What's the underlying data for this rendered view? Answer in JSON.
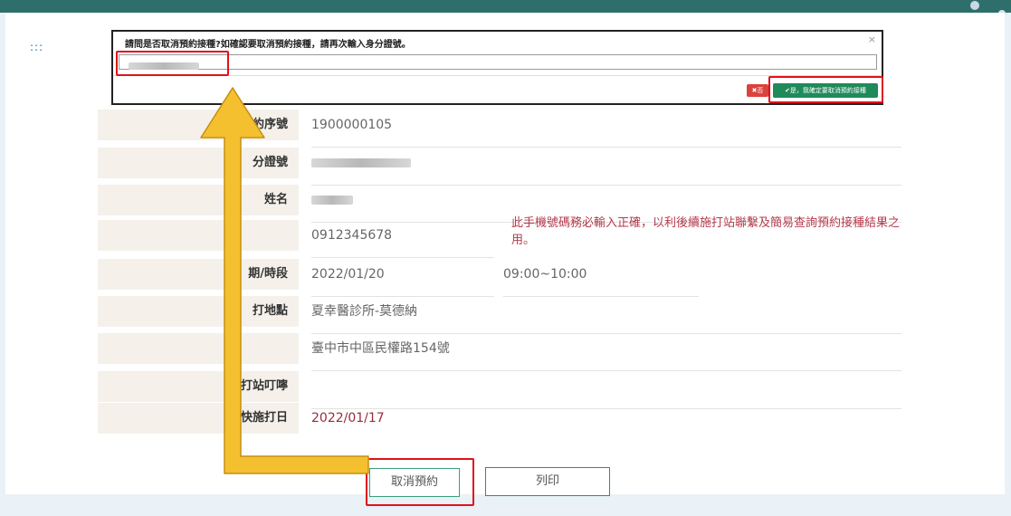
{
  "modal": {
    "prompt": "請問是否取消預約接種?如確認要取消預約接種，請再次輸入身分證號。",
    "close": "×",
    "no_label": "✖否",
    "yes_label": "✔是，我確定要取消預約接種"
  },
  "menu": {
    "dots": ":::"
  },
  "form": {
    "rows": [
      {
        "label": "約序號",
        "value": "1900000105"
      },
      {
        "label": "分證號",
        "value": ""
      },
      {
        "label": "姓名",
        "value": ""
      },
      {
        "label": "",
        "value": "0912345678",
        "note": "此手機號碼務必輸入正確，以利後續施打站聯繫及簡易查詢預約接種結果之用。"
      },
      {
        "label": "期/時段",
        "value": "2022/01/20",
        "value2": "09:00~10:00"
      },
      {
        "label": "打地點",
        "value": "夏幸醫診所-莫德納"
      },
      {
        "label": "",
        "value": "臺中市中區民權路154號"
      },
      {
        "label": "施打站叮嚀",
        "value": ""
      },
      {
        "label": "最快施打日",
        "value": "2022/01/17"
      }
    ]
  },
  "actions": {
    "cancel_label": "取消預約",
    "print_label": "列印"
  },
  "colors": {
    "accent": "#2f6f6b",
    "highlight": "#e0111b",
    "arrow": "#f5c030"
  }
}
